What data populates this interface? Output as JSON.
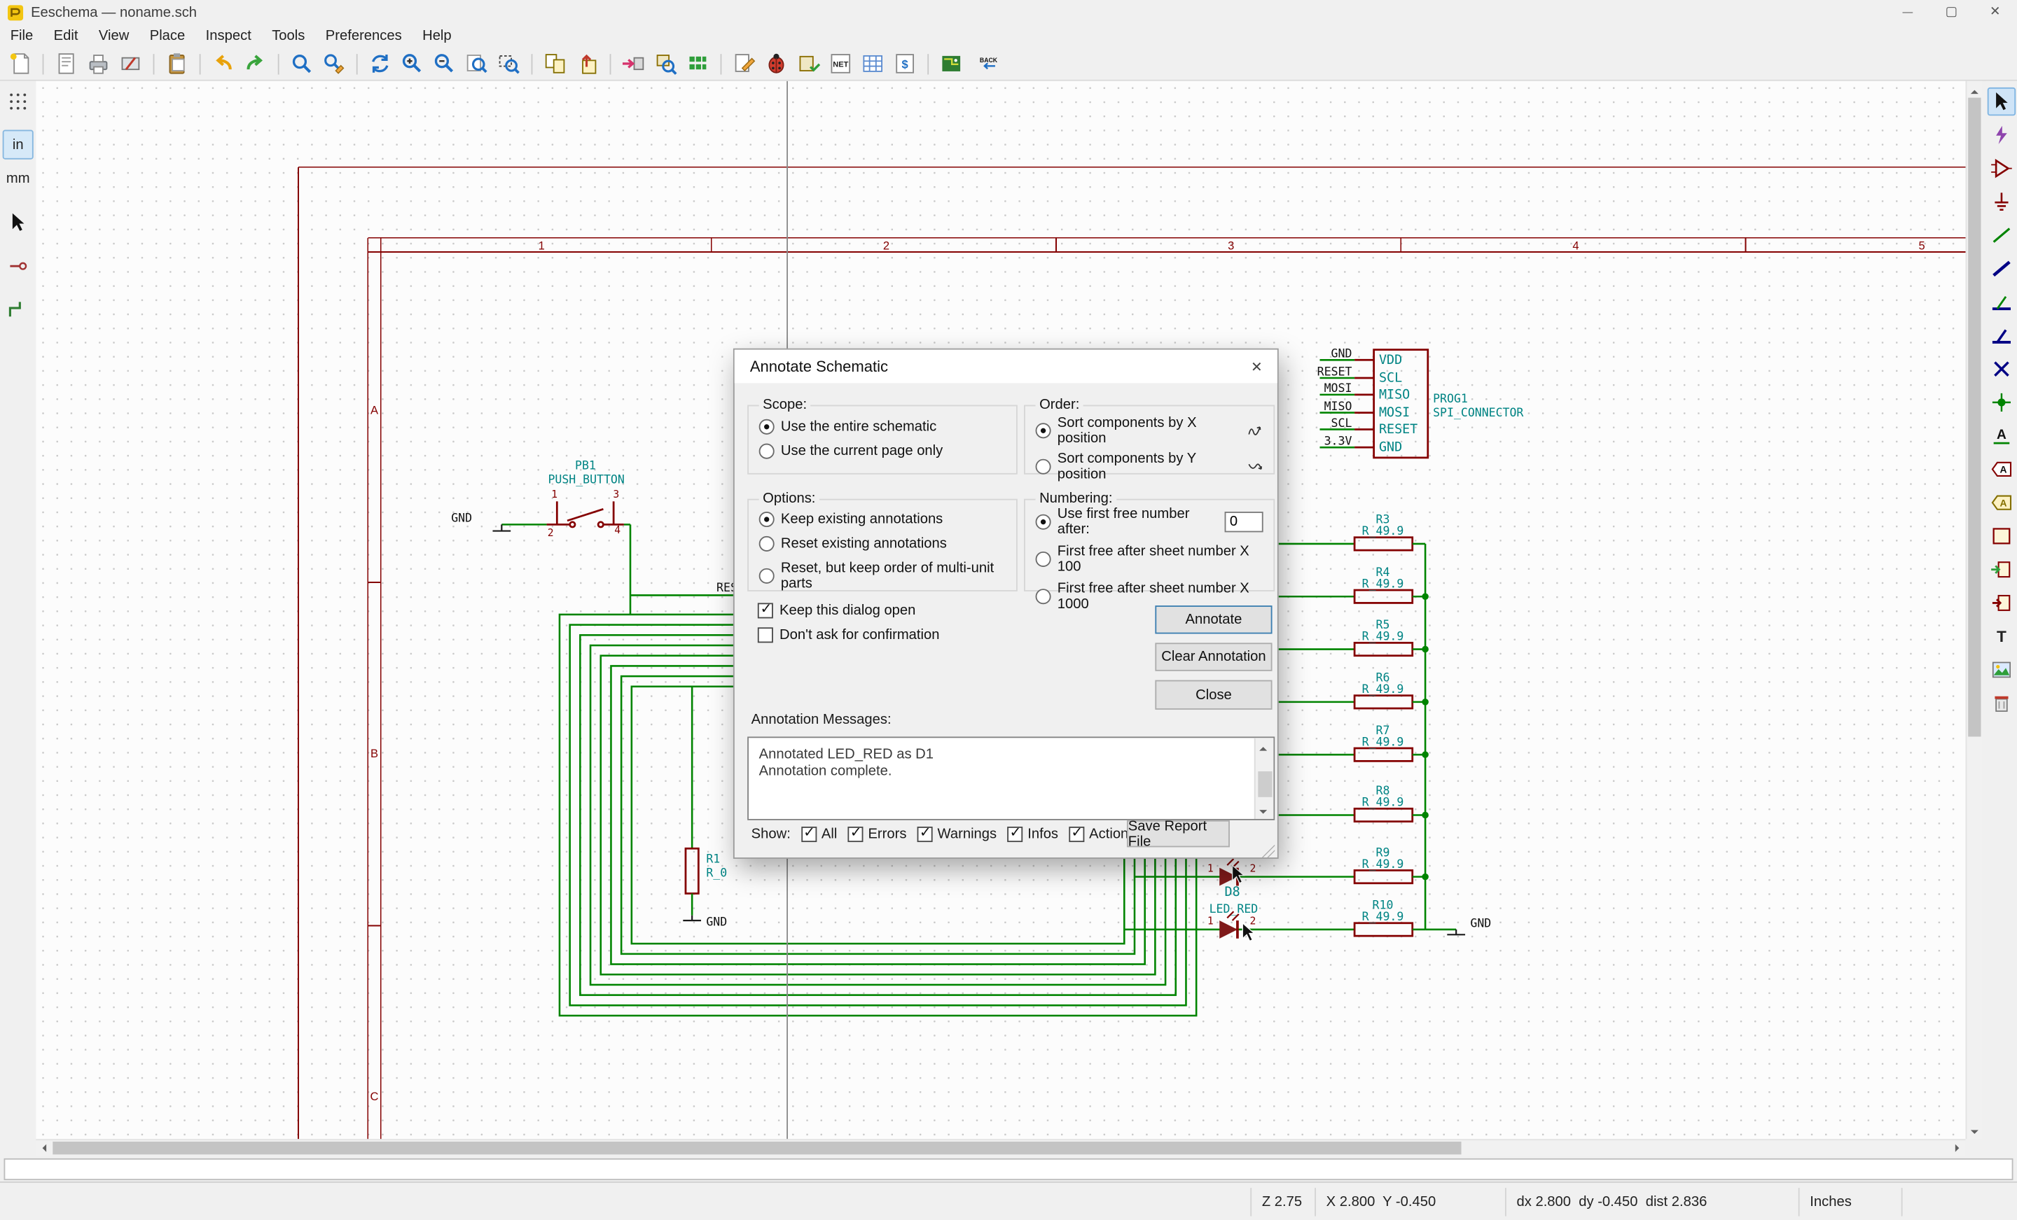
{
  "window": {
    "title": "Eeschema — noname.sch"
  },
  "menu": {
    "items": [
      "File",
      "Edit",
      "View",
      "Place",
      "Inspect",
      "Tools",
      "Preferences",
      "Help"
    ]
  },
  "toolbar": {
    "icon_texts": {
      "net": "NET",
      "bom": "$",
      "back": "BACK",
      "label_a": "A",
      "text_t": "T"
    }
  },
  "left_toolbar": {
    "units_in": "in",
    "units_mm": "mm"
  },
  "dialog": {
    "title": "Annotate Schematic",
    "scope": {
      "label": "Scope:",
      "option1": "Use the entire schematic",
      "option2": "Use the current page only"
    },
    "order": {
      "label": "Order:",
      "option1": "Sort components by X position",
      "option2": "Sort components by Y position"
    },
    "options": {
      "label": "Options:",
      "option1": "Keep existing annotations",
      "option2": "Reset existing annotations",
      "option3": "Reset, but keep order of multi-unit parts"
    },
    "numbering": {
      "label": "Numbering:",
      "option1": "Use first free number after:",
      "value": "0",
      "option2": "First free after sheet number X 100",
      "option3": "First free after sheet number X 1000"
    },
    "checkboxes": {
      "keep_open": "Keep this dialog open",
      "dont_ask": "Don't ask for confirmation"
    },
    "buttons": {
      "annotate": "Annotate",
      "clear": "Clear Annotation",
      "close": "Close",
      "save_report": "Save Report File"
    },
    "messages": {
      "label": "Annotation Messages:",
      "line1": "Annotated LED_RED as D1",
      "line2": "Annotation complete."
    },
    "show": {
      "label": "Show:",
      "all": "All",
      "errors": "Errors",
      "warnings": "Warnings",
      "infos": "Infos",
      "actions": "Actions"
    }
  },
  "schematic": {
    "frame": {
      "columns": [
        "1",
        "2",
        "3",
        "4",
        "5"
      ],
      "rows": [
        "A",
        "B",
        "C"
      ]
    },
    "gnd": "GND",
    "pushbutton": {
      "ref": "PB1",
      "value": "PUSH_BUTTON",
      "pin1": "1",
      "pin2": "2",
      "pin3": "3",
      "pin4": "4"
    },
    "reset_net": "RESET",
    "r1": {
      "ref": "R1",
      "value": "R_0"
    },
    "resistors": [
      {
        "ref": "R3",
        "value": "R_49.9"
      },
      {
        "ref": "R4",
        "value": "R_49.9"
      },
      {
        "ref": "R5",
        "value": "R_49.9"
      },
      {
        "ref": "R6",
        "value": "R_49.9"
      },
      {
        "ref": "R7",
        "value": "R_49.9"
      },
      {
        "ref": "R8",
        "value": "R_49.9"
      },
      {
        "ref": "R9",
        "value": "R_49.9"
      },
      {
        "ref": "R10",
        "value": "R_49.9"
      }
    ],
    "led": {
      "ref": "D8",
      "value": "LED_RED",
      "pin1": "1",
      "pin2": "2"
    },
    "connector": {
      "ref": "PROG1",
      "value": "SPI_CONNECTOR",
      "pins": [
        "VDD",
        "SCL",
        "MISO",
        "MOSI",
        "RESET",
        "GND"
      ],
      "nets": [
        "GND",
        "RESET",
        "MOSI",
        "MISO",
        "SCL",
        "3.3V"
      ]
    },
    "colors": {
      "wire": "#008400",
      "component": "#840000",
      "text": "#008484",
      "frame": "#840000"
    }
  },
  "status_bar": {
    "zoom": "Z 2.75",
    "position": "X 2.800  Y -0.450",
    "delta": "dx 2.800  dy -0.450  dist 2.836",
    "units": "Inches"
  }
}
